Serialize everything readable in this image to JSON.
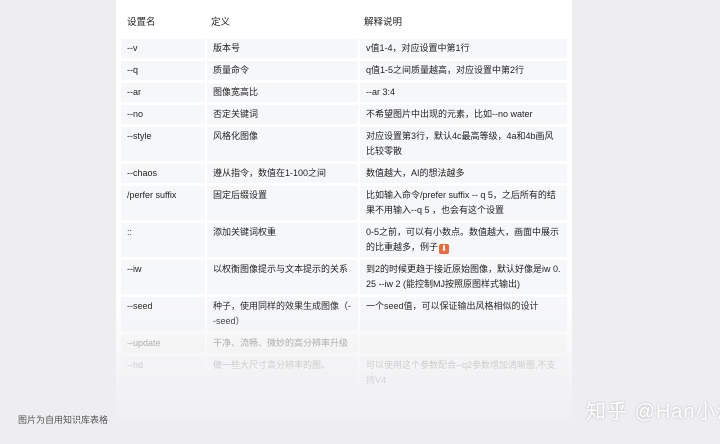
{
  "table": {
    "headers": [
      "设置名",
      "定义",
      "解释说明"
    ],
    "rows": [
      [
        "--v",
        "版本号",
        "v值1-4，对应设置中第1行"
      ],
      [
        "--q",
        "质量命令",
        "q值1-5之间质量越高，对应设置中第2行"
      ],
      [
        "--ar",
        "图像宽高比",
        "--ar 3:4"
      ],
      [
        "--no",
        "否定关键词",
        "不希望图片中出现的元素，比如--no water"
      ],
      [
        "--style",
        "风格化图像",
        "对应设置第3行，默认4c最高等级，4a和4b画风比较零散"
      ],
      [
        "--chaos",
        "遵从指令，数值在1-100之间",
        "数值越大，AI的想法越多"
      ],
      [
        "/perfer suffix",
        "固定后缀设置",
        "比如输入命令/prefer suffix -- q 5，之后所有的结果不用输入--q 5 ，也会有这个设置"
      ],
      [
        "::",
        "添加关键词权重",
        "0-5之前，可以有小数点。数值越大，画面中展示的比重越多，例子"
      ],
      [
        "--iw",
        "以权衡图像提示与文本提示的关系",
        "到2的时候更趋于接近原始图像，默认好像是iw 0.25 --iw 2 (能控制MJ按照原图样式输出)"
      ],
      [
        "--seed",
        "种子，使用同样的效果生成图像（--seed）",
        "一个seed值，可以保证输出风格相似的设计"
      ],
      [
        "--update",
        "干净、流畅、微妙的高分辨率升级",
        ""
      ],
      [
        "--hd",
        "做一些大尺寸高分辨率的图。",
        "可以使用这个参数配合--q2参数增加清晰图,不支持V4"
      ]
    ]
  },
  "emoji": "⬇",
  "caption": "图片为自用知识库表格",
  "watermark": "知乎 @Han小满"
}
